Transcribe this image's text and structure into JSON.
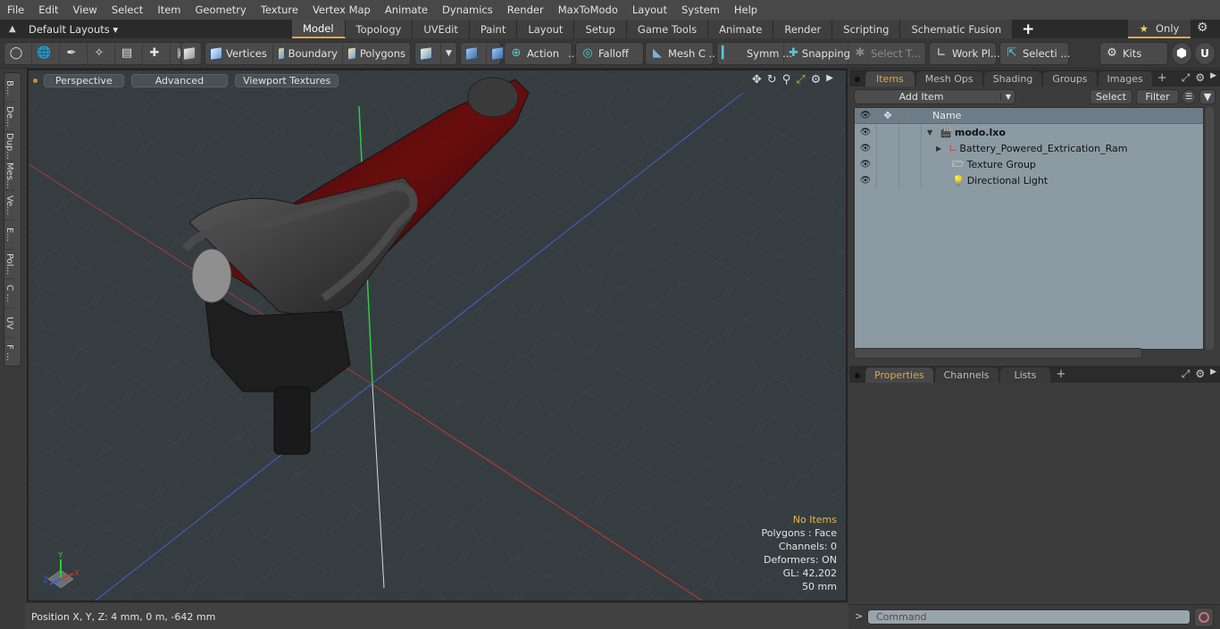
{
  "menu": [
    "File",
    "Edit",
    "View",
    "Select",
    "Item",
    "Geometry",
    "Texture",
    "Vertex Map",
    "Animate",
    "Dynamics",
    "Render",
    "MaxToModo",
    "Layout",
    "System",
    "Help"
  ],
  "layoutbar": {
    "layout_select": "Default Layouts ▾",
    "tabs": [
      "Model",
      "Topology",
      "UVEdit",
      "Paint",
      "Layout",
      "Setup",
      "Game Tools",
      "Animate",
      "Render",
      "Scripting",
      "Schematic Fusion"
    ],
    "active_tab": "Model",
    "only_label": "Only"
  },
  "toolbar": {
    "vertices": "Vertices",
    "boundary": "Boundary",
    "polygons": "Polygons",
    "action": "Action",
    "action_more": "...",
    "falloff": "Falloff",
    "mesh_c": "Mesh C ...",
    "symm": "Symm ...",
    "snapping": "Snapping",
    "select_t": "Select T...",
    "work_pl": "Work Pl...",
    "selecti": "Selecti ...",
    "kits": "Kits"
  },
  "left_tabs": [
    "B...",
    "De...",
    "Dup...",
    "Mes...",
    "Ve...",
    "E...",
    "Pol...",
    "C ...",
    "UV",
    "F ..."
  ],
  "viewport": {
    "view_mode": "Perspective",
    "shading": "Advanced",
    "textures": "Viewport Textures",
    "info": {
      "items": "No Items",
      "polygons": "Polygons : Face",
      "channels": "Channels: 0",
      "deformers": "Deformers: ON",
      "gl": "GL: 42,202",
      "scale": "50 mm"
    },
    "axis_labels": {
      "x": "X",
      "y": "Y",
      "z": "Z"
    }
  },
  "status": {
    "position": "Position X, Y, Z:   4 mm, 0 m, -642 mm"
  },
  "items_panel": {
    "tabs": [
      "Items",
      "Mesh Ops",
      "Shading",
      "Groups",
      "Images"
    ],
    "active_tab": "Items",
    "add_item": "Add Item",
    "select": "Select",
    "filter": "Filter",
    "column_name": "Name",
    "rows": [
      {
        "name": "modo.lxo",
        "icon": "scene-icon",
        "level": 0,
        "expanded": true
      },
      {
        "name": "Battery_Powered_Extrication_Ram",
        "icon": "mesh-locator-icon",
        "level": 1,
        "expandable": true
      },
      {
        "name": "Texture Group",
        "icon": "texture-group-icon",
        "level": 1
      },
      {
        "name": "Directional Light",
        "icon": "light-icon",
        "level": 1
      }
    ]
  },
  "properties_panel": {
    "tabs": [
      "Properties",
      "Channels",
      "Lists"
    ],
    "active_tab": "Properties"
  },
  "command": {
    "prompt": ">",
    "placeholder": "Command"
  },
  "colors": {
    "accent": "#e4a54a",
    "active_tab_text": "#e9a53a",
    "info_highlight": "#e9b54a",
    "x_axis": "#c0392b",
    "y_axis": "#2ecc40",
    "z_axis": "#4a5fd0"
  }
}
